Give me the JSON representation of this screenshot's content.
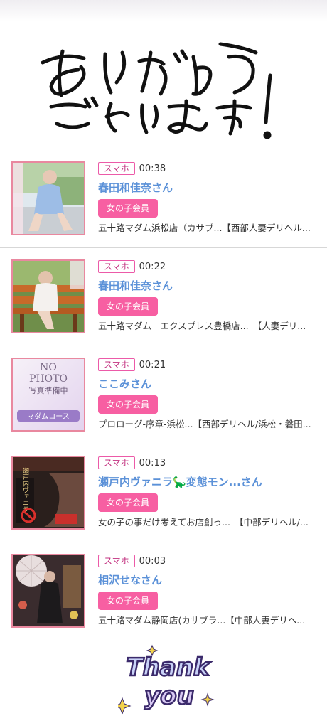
{
  "header": {
    "title_line1": "ありがとう",
    "title_line2": "ございます!"
  },
  "colors": {
    "accent_pink": "#f75fa2",
    "badge_border": "#ec5aa8",
    "name_blue": "#5b91d8",
    "thumb_border": "#e9889f"
  },
  "entries": [
    {
      "device": "スマホ",
      "time": "00:38",
      "name": "春田和佳奈さん",
      "member_badge": "女の子会員",
      "shop": "五十路マダム浜松店（カサブ...【西部人妻デリヘル..."
    },
    {
      "device": "スマホ",
      "time": "00:22",
      "name": "春田和佳奈さん",
      "member_badge": "女の子会員",
      "shop": "五十路マダム　エクスプレス豊橋店...　【人妻デリ..."
    },
    {
      "device": "スマホ",
      "time": "00:21",
      "name": "ここみさん",
      "member_badge": "女の子会員",
      "shop": "プロローグ-序章-浜松...【西部デリヘル/浜松・磐田..."
    },
    {
      "device": "スマホ",
      "time": "00:13",
      "name": "瀬戸内ヴァニラ🦕変態モン...さん",
      "member_badge": "女の子会員",
      "shop": "女の子の事だけ考えてお店創っ...　【中部デリヘル/..."
    },
    {
      "device": "スマホ",
      "time": "00:03",
      "name": "相沢せなさん",
      "member_badge": "女の子会員",
      "shop": "五十路マダム静岡店(カサブラ...【中部人妻デリヘ..."
    }
  ],
  "thumbnails": {
    "photo3_line1": "NO",
    "photo3_line2": "PHOTO",
    "photo3_line3": "写真準備中",
    "photo3_line4": "マダムコース",
    "photo4_text": "瀬戸内ヴァニラ"
  },
  "footer": {
    "thank_line1": "Thank",
    "thank_line2": "you"
  }
}
